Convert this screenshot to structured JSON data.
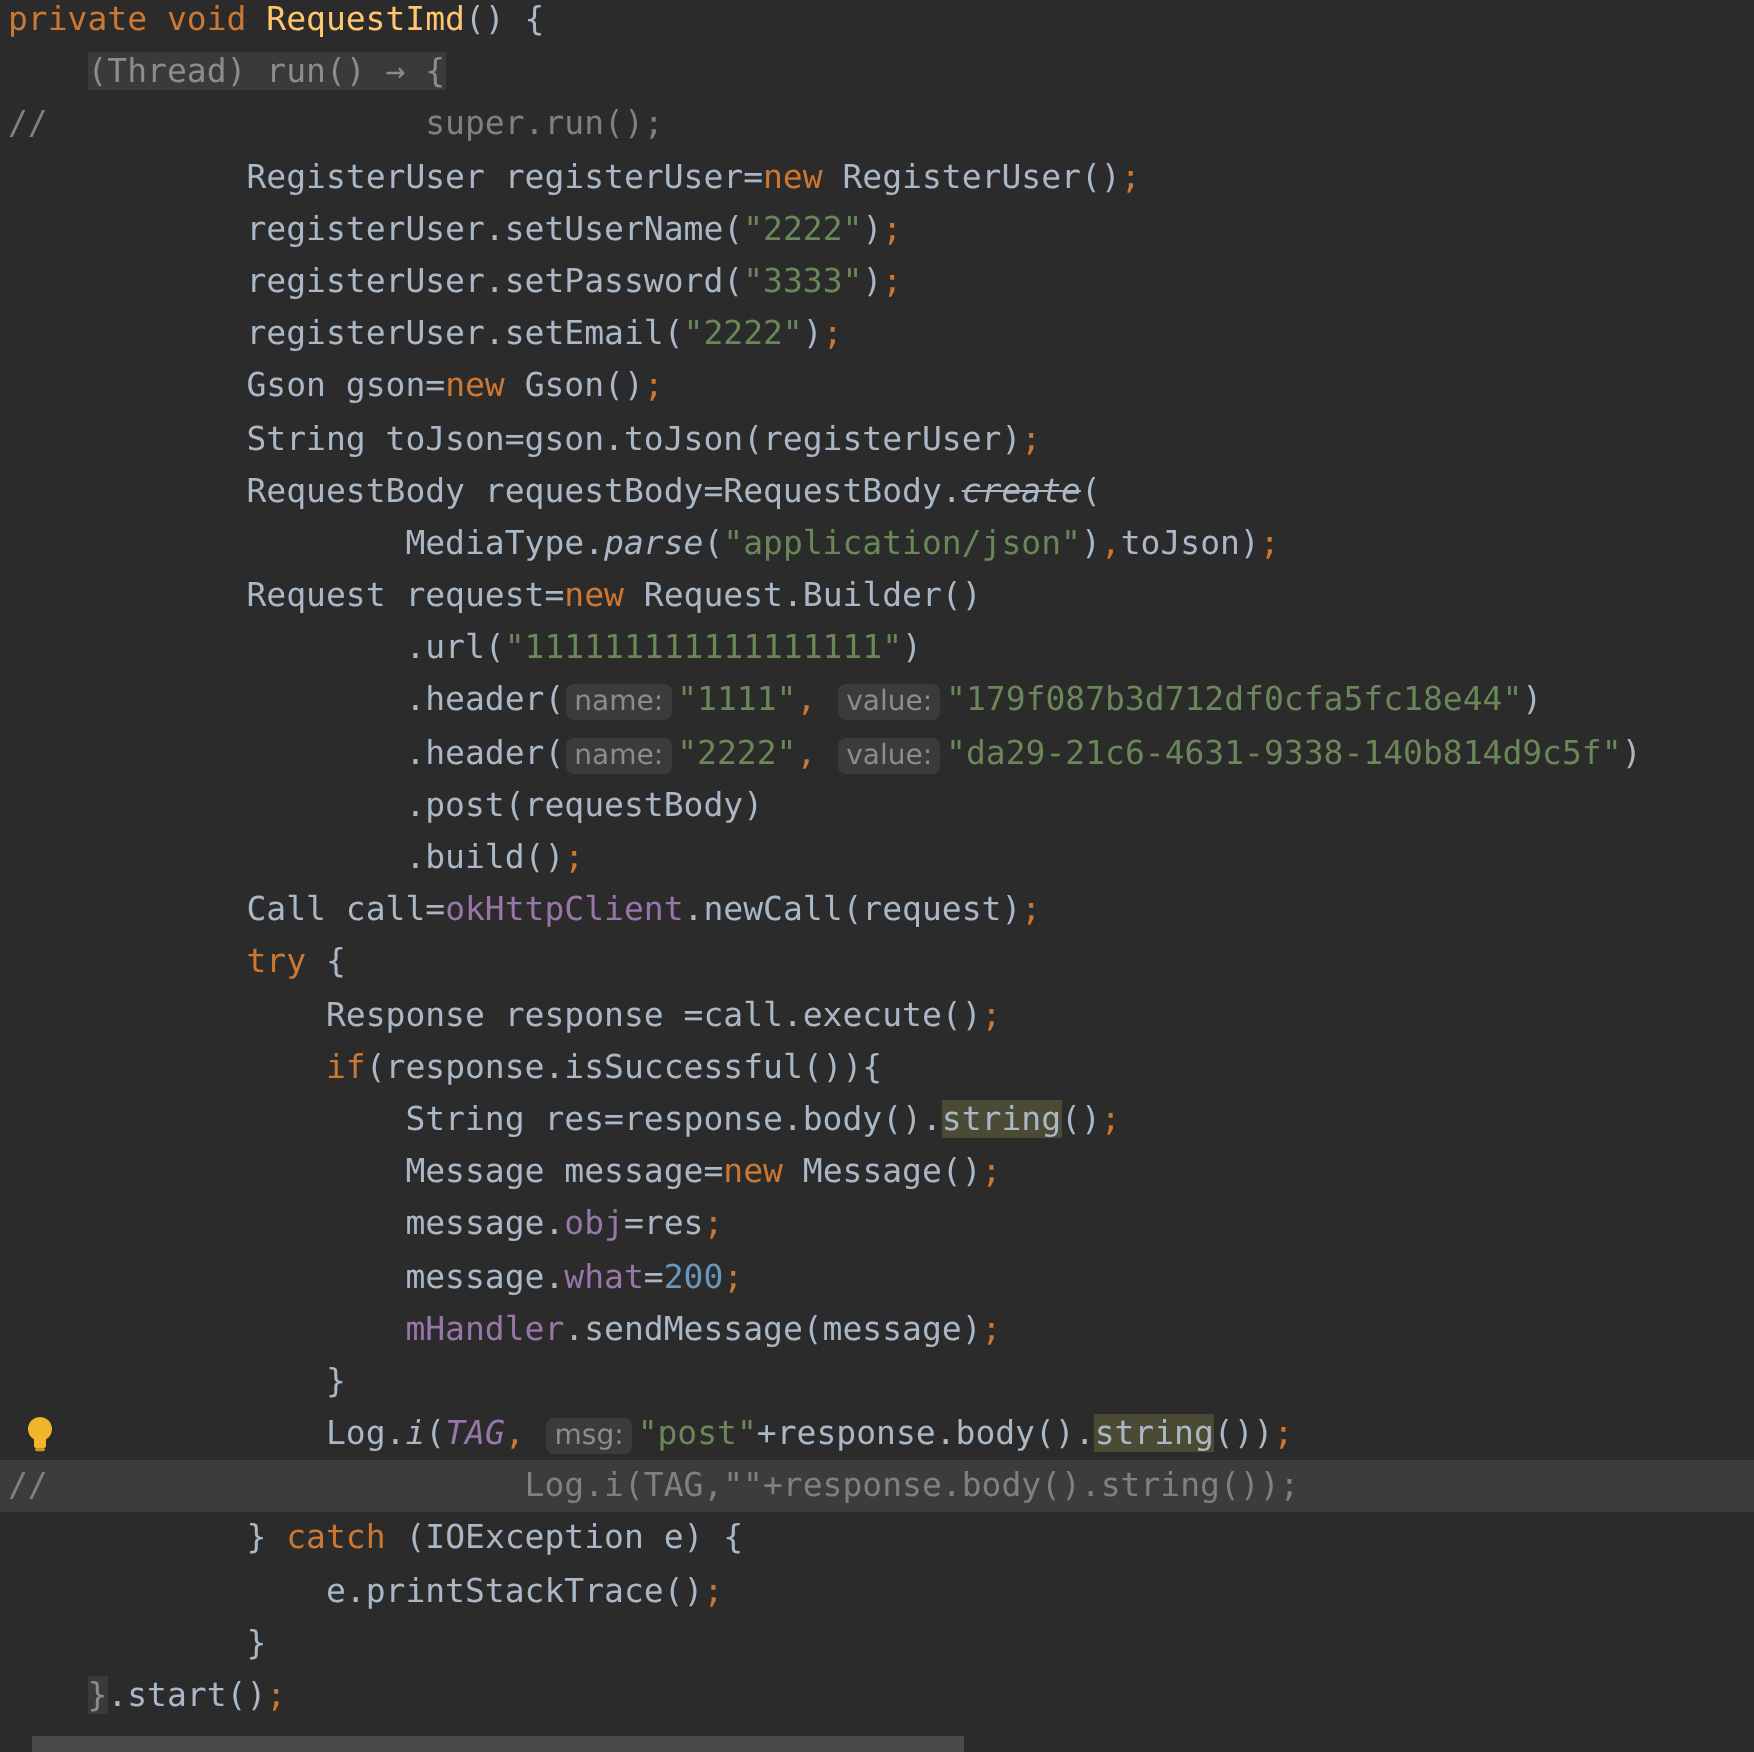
{
  "editor": {
    "lines": [
      {
        "tokens": [
          {
            "kind": "keyword",
            "text": "private void "
          },
          {
            "kind": "method",
            "text": "RequestImd"
          },
          {
            "kind": "plain",
            "text": "() {"
          }
        ]
      },
      {
        "tokens": [
          {
            "kind": "fold",
            "text": "    (Thread) run() → {"
          }
        ]
      },
      {
        "tokens": [
          {
            "kind": "comment",
            "text": "//                   super.run();"
          }
        ]
      },
      {
        "tokens": [
          {
            "kind": "plain",
            "text": "            RegisterUser registerUser="
          },
          {
            "kind": "keyword",
            "text": "new "
          },
          {
            "kind": "plain",
            "text": "RegisterUser()"
          },
          {
            "kind": "keyword",
            "text": ";"
          }
        ]
      },
      {
        "tokens": [
          {
            "kind": "plain",
            "text": "            registerUser.setUserName("
          },
          {
            "kind": "string",
            "text": "\"2222\""
          },
          {
            "kind": "plain",
            "text": ")"
          },
          {
            "kind": "keyword",
            "text": ";"
          }
        ]
      },
      {
        "tokens": [
          {
            "kind": "plain",
            "text": "            registerUser.setPassword("
          },
          {
            "kind": "string",
            "text": "\"3333\""
          },
          {
            "kind": "plain",
            "text": ")"
          },
          {
            "kind": "keyword",
            "text": ";"
          }
        ]
      },
      {
        "tokens": [
          {
            "kind": "plain",
            "text": "            registerUser.setEmail("
          },
          {
            "kind": "string",
            "text": "\"2222\""
          },
          {
            "kind": "plain",
            "text": ")"
          },
          {
            "kind": "keyword",
            "text": ";"
          }
        ]
      },
      {
        "tokens": [
          {
            "kind": "plain",
            "text": "            Gson gson="
          },
          {
            "kind": "keyword",
            "text": "new "
          },
          {
            "kind": "plain",
            "text": "Gson()"
          },
          {
            "kind": "keyword",
            "text": ";"
          }
        ]
      },
      {
        "tokens": [
          {
            "kind": "plain",
            "text": "            String toJson=gson.toJson(registerUser)"
          },
          {
            "kind": "keyword",
            "text": ";"
          }
        ]
      },
      {
        "tokens": [
          {
            "kind": "plain",
            "text": "            RequestBody requestBody=RequestBody."
          },
          {
            "kind": "deprecated",
            "text": "create"
          },
          {
            "kind": "plain",
            "text": "("
          }
        ]
      },
      {
        "tokens": [
          {
            "kind": "plain",
            "text": "                    MediaType."
          },
          {
            "kind": "italic",
            "text": "parse"
          },
          {
            "kind": "plain",
            "text": "("
          },
          {
            "kind": "string",
            "text": "\"application/json\""
          },
          {
            "kind": "plain",
            "text": ")"
          },
          {
            "kind": "keyword",
            "text": ","
          },
          {
            "kind": "plain",
            "text": "toJson)"
          },
          {
            "kind": "keyword",
            "text": ";"
          }
        ]
      },
      {
        "tokens": [
          {
            "kind": "plain",
            "text": "            Request request="
          },
          {
            "kind": "keyword",
            "text": "new "
          },
          {
            "kind": "plain",
            "text": "Request.Builder()"
          }
        ]
      },
      {
        "tokens": [
          {
            "kind": "plain",
            "text": "                    .url("
          },
          {
            "kind": "string",
            "text": "\"111111111111111111\""
          },
          {
            "kind": "plain",
            "text": ")"
          }
        ]
      },
      {
        "tokens": [
          {
            "kind": "plain",
            "text": "                    .header("
          },
          {
            "kind": "hint",
            "text": "name:"
          },
          {
            "kind": "string",
            "text": "\"1111\""
          },
          {
            "kind": "keyword",
            "text": ", "
          },
          {
            "kind": "hint",
            "text": "value:"
          },
          {
            "kind": "string",
            "text": "\"179f087b3d712df0cfa5fc18e44\""
          },
          {
            "kind": "plain",
            "text": ")"
          }
        ]
      },
      {
        "tokens": [
          {
            "kind": "plain",
            "text": "                    .header("
          },
          {
            "kind": "hint",
            "text": "name:"
          },
          {
            "kind": "string",
            "text": "\"2222\""
          },
          {
            "kind": "keyword",
            "text": ", "
          },
          {
            "kind": "hint",
            "text": "value:"
          },
          {
            "kind": "string",
            "text": "\"da29-21c6-4631-9338-140b814d9c5f\""
          },
          {
            "kind": "plain",
            "text": ")"
          }
        ]
      },
      {
        "tokens": [
          {
            "kind": "plain",
            "text": "                    .post(requestBody)"
          }
        ]
      },
      {
        "tokens": [
          {
            "kind": "plain",
            "text": "                    .build()"
          },
          {
            "kind": "keyword",
            "text": ";"
          }
        ]
      },
      {
        "tokens": [
          {
            "kind": "plain",
            "text": "            Call call="
          },
          {
            "kind": "field",
            "text": "okHttpClient"
          },
          {
            "kind": "plain",
            "text": ".newCall(request)"
          },
          {
            "kind": "keyword",
            "text": ";"
          }
        ]
      },
      {
        "tokens": [
          {
            "kind": "keyword",
            "text": "            try "
          },
          {
            "kind": "plain",
            "text": "{"
          }
        ]
      },
      {
        "tokens": [
          {
            "kind": "plain",
            "text": "                Response response =call.execute()"
          },
          {
            "kind": "keyword",
            "text": ";"
          }
        ]
      },
      {
        "tokens": [
          {
            "kind": "keyword",
            "text": "                if"
          },
          {
            "kind": "plain",
            "text": "(response.isSuccessful()){"
          }
        ]
      },
      {
        "tokens": [
          {
            "kind": "plain",
            "text": "                    String res=response.body()."
          },
          {
            "kind": "match",
            "text": "string"
          },
          {
            "kind": "plain",
            "text": "()"
          },
          {
            "kind": "keyword",
            "text": ";"
          }
        ]
      },
      {
        "tokens": [
          {
            "kind": "plain",
            "text": "                    Message message="
          },
          {
            "kind": "keyword",
            "text": "new "
          },
          {
            "kind": "plain",
            "text": "Message()"
          },
          {
            "kind": "keyword",
            "text": ";"
          }
        ]
      },
      {
        "tokens": [
          {
            "kind": "plain",
            "text": "                    message."
          },
          {
            "kind": "field",
            "text": "obj"
          },
          {
            "kind": "plain",
            "text": "=res"
          },
          {
            "kind": "keyword",
            "text": ";"
          }
        ]
      },
      {
        "tokens": [
          {
            "kind": "plain",
            "text": "                    message."
          },
          {
            "kind": "field",
            "text": "what"
          },
          {
            "kind": "plain",
            "text": "="
          },
          {
            "kind": "number",
            "text": "200"
          },
          {
            "kind": "keyword",
            "text": ";"
          }
        ]
      },
      {
        "tokens": [
          {
            "kind": "field",
            "text": "                    mHandler"
          },
          {
            "kind": "plain",
            "text": ".sendMessage(message)"
          },
          {
            "kind": "keyword",
            "text": ";"
          }
        ]
      },
      {
        "tokens": [
          {
            "kind": "plain",
            "text": "                }"
          }
        ]
      },
      {
        "bulb": true,
        "tokens": [
          {
            "kind": "plain",
            "text": "                Log."
          },
          {
            "kind": "italic",
            "text": "i"
          },
          {
            "kind": "plain",
            "text": "("
          },
          {
            "kind": "static",
            "text": "TAG"
          },
          {
            "kind": "keyword",
            "text": ", "
          },
          {
            "kind": "hint",
            "text": "msg:"
          },
          {
            "kind": "string",
            "text": "\"post\""
          },
          {
            "kind": "plain",
            "text": "+response.body()."
          },
          {
            "kind": "match",
            "text": "string"
          },
          {
            "kind": "plain",
            "text": "())"
          },
          {
            "kind": "keyword",
            "text": ";"
          }
        ]
      },
      {
        "current": true,
        "tokens": [
          {
            "kind": "comment",
            "text": "//                        Log.i(TAG,\"\"+response.body().string());"
          }
        ]
      },
      {
        "tokens": [
          {
            "kind": "plain",
            "text": "            } "
          },
          {
            "kind": "keyword",
            "text": "catch "
          },
          {
            "kind": "plain",
            "text": "(IOException e) {"
          }
        ]
      },
      {
        "tokens": [
          {
            "kind": "plain",
            "text": "                e.printStackTrace()"
          },
          {
            "kind": "keyword",
            "text": ";"
          }
        ]
      },
      {
        "tokens": [
          {
            "kind": "plain",
            "text": "            }"
          }
        ]
      },
      {
        "tokens": [
          {
            "kind": "fold",
            "text": "    }"
          },
          {
            "kind": "plain",
            "text": ".start()"
          },
          {
            "kind": "keyword",
            "text": ";"
          }
        ]
      }
    ]
  }
}
